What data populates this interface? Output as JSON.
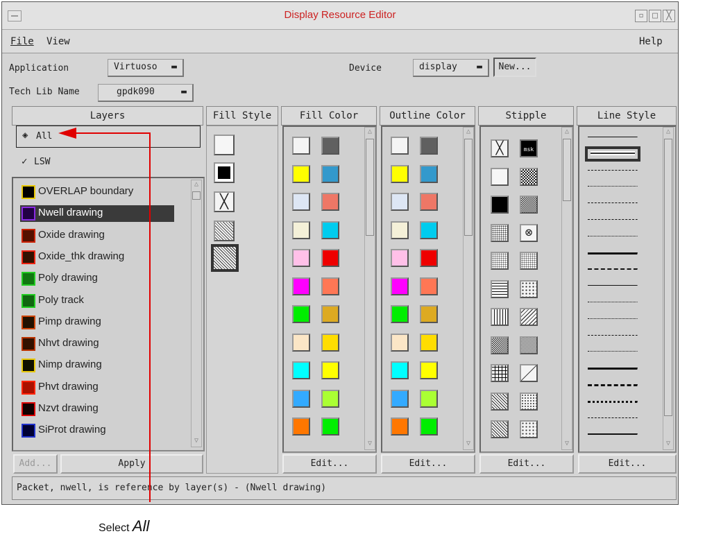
{
  "window": {
    "title": "Display Resource Editor"
  },
  "menu": {
    "file": "File",
    "view": "View",
    "help": "Help"
  },
  "toolbar": {
    "application_label": "Application",
    "application_value": "Virtuoso",
    "device_label": "Device",
    "device_value": "display",
    "new_button": "New...",
    "techlib_label": "Tech Lib Name",
    "techlib_value": "gpdk090"
  },
  "columns": {
    "layers": "Layers",
    "fill_style": "Fill Style",
    "fill_color": "Fill Color",
    "outline_color": "Outline Color",
    "stipple": "Stipple",
    "line_style": "Line Style"
  },
  "layer_filter": {
    "all": "All",
    "lsw": "LSW"
  },
  "layers": [
    {
      "name": "OVERLAP boundary",
      "color": "#000000",
      "border": "#e8c800"
    },
    {
      "name": "Nwell drawing",
      "color": "#220044",
      "border": "#8a2be2",
      "selected": true
    },
    {
      "name": "Oxide drawing",
      "color": "#551100",
      "border": "#cc2200"
    },
    {
      "name": "Oxide_thk drawing",
      "color": "#331100",
      "border": "#ee2211"
    },
    {
      "name": "Poly drawing",
      "color": "#117711",
      "border": "#22cc22"
    },
    {
      "name": "Poly track",
      "color": "#116611",
      "border": "#22cc22"
    },
    {
      "name": "Pimp drawing",
      "color": "#221100",
      "border": "#cc4400"
    },
    {
      "name": "Nhvt drawing",
      "color": "#331100",
      "border": "#bb3300"
    },
    {
      "name": "Nimp drawing",
      "color": "#111100",
      "border": "#e8c800"
    },
    {
      "name": "Phvt drawing",
      "color": "#aa1100",
      "border": "#ff2200"
    },
    {
      "name": "Nzvt drawing",
      "color": "#110000",
      "border": "#dd0000"
    },
    {
      "name": "SiProt drawing",
      "color": "#000033",
      "border": "#2233cc"
    }
  ],
  "colors": {
    "left": [
      "#f4f4f4",
      "#ffff00",
      "#dde6f4",
      "#f4f0d8",
      "#ffc0e8",
      "#ff00ff",
      "#00ee00",
      "#fbe6c6",
      "#00ffff",
      "#33aaff",
      "#ff7700"
    ],
    "right": [
      "#606060",
      "#3399cc",
      "#ee7766",
      "#00ccee",
      "#ee0000",
      "#ff7755",
      "#ddaa22",
      "#ffdd00",
      "#ffff00",
      "#aaff33",
      "#00ee00"
    ]
  },
  "buttons": {
    "add": "Add...",
    "apply": "Apply",
    "edit": "Edit..."
  },
  "stipple_label": "msk",
  "status": "Packet, nwell, is reference by layer(s) - (Nwell drawing)",
  "annotation": {
    "text_prefix": "Select ",
    "text_emph": "All"
  }
}
